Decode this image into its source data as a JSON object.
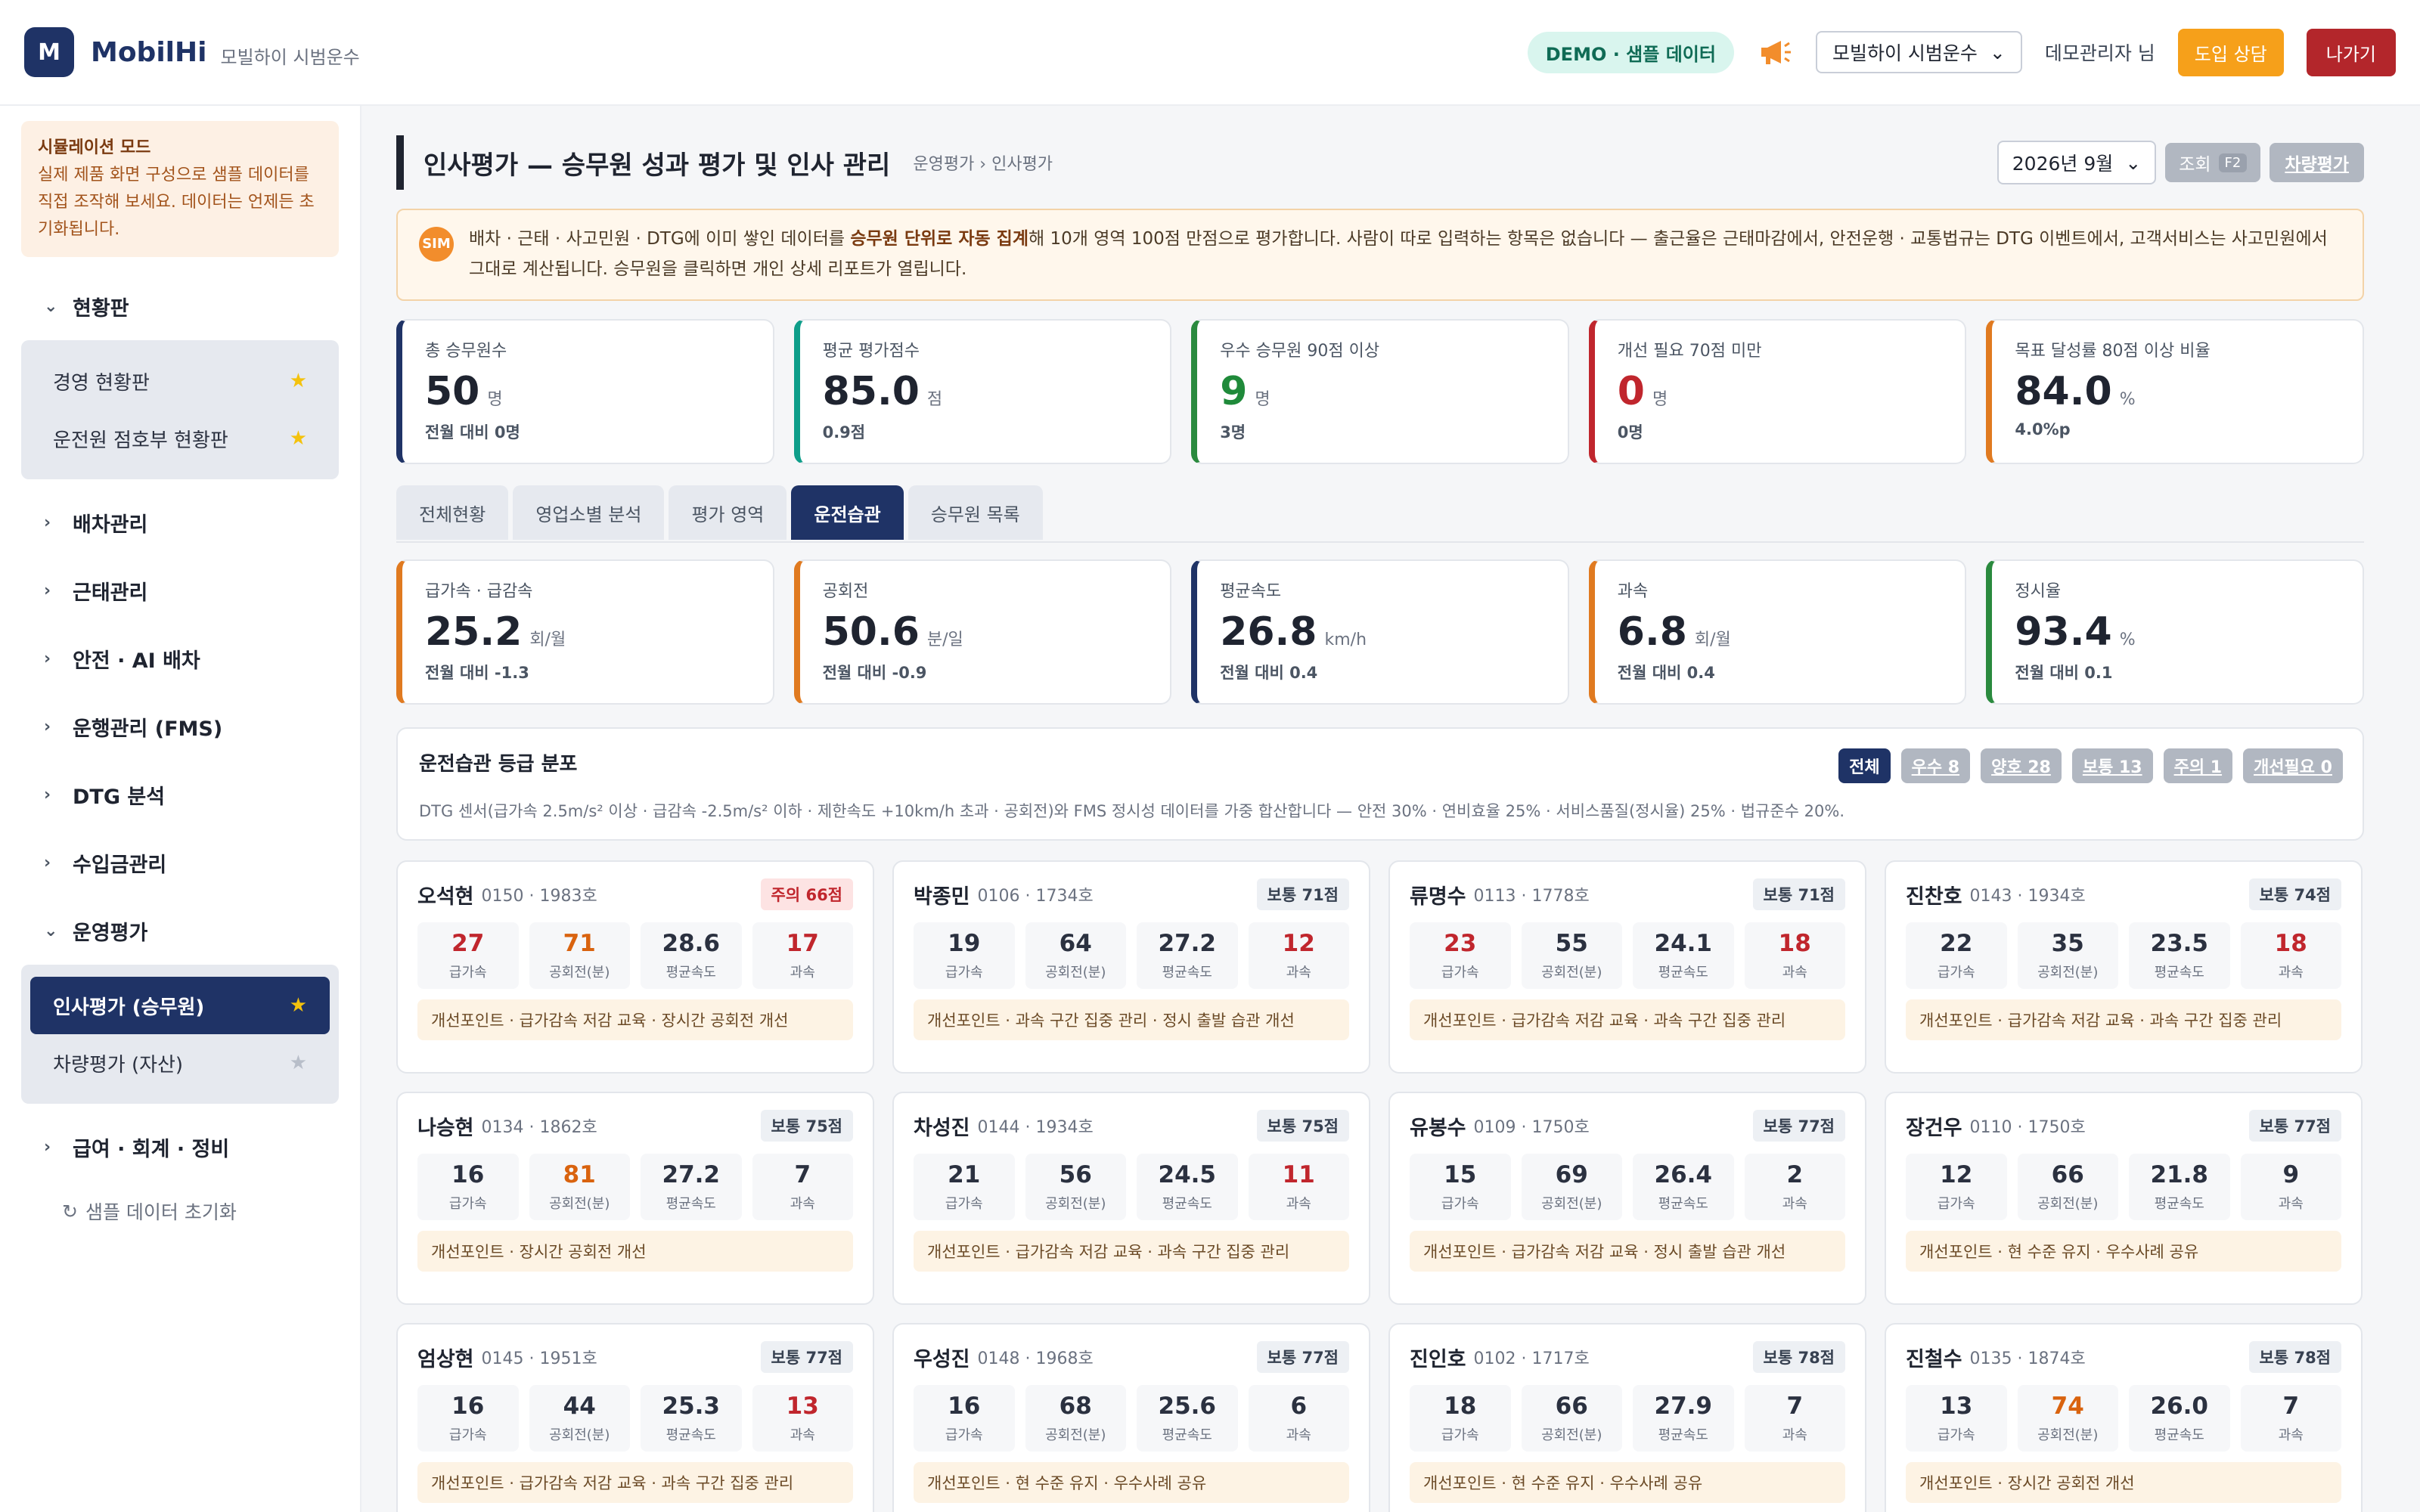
{
  "app": {
    "logo_letter": "M",
    "brand": "MobilHi",
    "brand_sub": "모빌하이 시범운수"
  },
  "header": {
    "demo_badge": "DEMO · 샘플 데이터",
    "company_select": "모빌하이 시범운수",
    "user": "데모관리자 님",
    "consult_button": "도입 상담",
    "exit_button": "나가기"
  },
  "sidebar": {
    "sim_title": "시뮬레이션 모드",
    "sim_text": "실제 제품 화면 구성으로 샘플 데이터를 직접 조작해 보세요. 데이터는 언제든 초기화됩니다.",
    "sections": [
      {
        "label": "현황판",
        "expanded": true
      },
      {
        "label": "배차관리"
      },
      {
        "label": "근태관리"
      },
      {
        "label": "안전 · AI 배차"
      },
      {
        "label": "운행관리 (FMS)"
      },
      {
        "label": "DTG 분석"
      },
      {
        "label": "수입금관리"
      },
      {
        "label": "운영평가",
        "expanded": true
      },
      {
        "label": "급여 · 회계 · 정비"
      }
    ],
    "dashboard_items": [
      "경영 현황판",
      "운전원 점호부 현황판"
    ],
    "eval_items": [
      "인사평가 (승무원)",
      "차량평가 (자산)"
    ],
    "reset": "샘플 데이터 초기화"
  },
  "page": {
    "title": "인사평가 — 승무원 성과 평가 및 인사 관리",
    "breadcrumb": "운영평가 › 인사평가",
    "month": "2026년 9월",
    "query_button": "조회",
    "query_key": "F2",
    "vehicle_button": "차량평가"
  },
  "info": {
    "icon": "SIM",
    "p1": "배차 · 근태 · 사고민원 · DTG에 이미 쌓인 데이터를 ",
    "bold": "승무원 단위로 자동 집계",
    "p2": "해 10개 영역 100점 만점으로 평가합니다. 사람이 따로 입력하는 항목은 없습니다 — 출근율은 근태마감에서, 안전운행 · 교통법규는 DTG 이벤트에서, 고객서비스는 사고민원에서 그대로 계산됩니다. 승무원을 클릭하면 개인 상세 리포트가 열립니다."
  },
  "kpis": [
    {
      "label": "총 승무원수",
      "value": "50",
      "unit": "명",
      "sub": "전월 대비 0명"
    },
    {
      "label": "평균 평가점수",
      "value": "85.0",
      "unit": "점",
      "sub": "0.9점"
    },
    {
      "label": "우수 승무원 90점 이상",
      "value": "9",
      "unit": "명",
      "sub": "3명"
    },
    {
      "label": "개선 필요 70점 미만",
      "value": "0",
      "unit": "명",
      "sub": "0명"
    },
    {
      "label": "목표 달성률 80점 이상 비율",
      "value": "84.0",
      "unit": "%",
      "sub": "4.0%p"
    }
  ],
  "tabs": [
    "전체현황",
    "영업소별 분석",
    "평가 영역",
    "운전습관",
    "승무원 목록"
  ],
  "habits": [
    {
      "label": "급가속 · 급감속",
      "value": "25.2",
      "unit": "회/월",
      "sub": "전월 대비 -1.3"
    },
    {
      "label": "공회전",
      "value": "50.6",
      "unit": "분/일",
      "sub": "전월 대비 -0.9"
    },
    {
      "label": "평균속도",
      "value": "26.8",
      "unit": "km/h",
      "sub": "전월 대비 0.4"
    },
    {
      "label": "과속",
      "value": "6.8",
      "unit": "회/월",
      "sub": "전월 대비 0.4"
    },
    {
      "label": "정시율",
      "value": "93.4",
      "unit": "%",
      "sub": "전월 대비 0.1"
    }
  ],
  "distribution": {
    "title": "운전습관 등급 분포",
    "desc": "DTG 센서(급가속 2.5m/s² 이상 · 급감속 -2.5m/s² 이하 · 제한속도 +10km/h 초과 · 공회전)와 FMS 정시성 데이터를 가중 합산합니다 — 안전 30% · 연비효율 25% · 서비스품질(정시율) 25% · 법규준수 20%.",
    "filters": [
      "전체",
      "우수 8",
      "양호 28",
      "보통 13",
      "주의 1",
      "개선필요 0"
    ]
  },
  "metric_labels": [
    "급가속",
    "공회전(분)",
    "평균속도",
    "과속"
  ],
  "drivers": [
    {
      "name": "오석현",
      "id": "0150 · 1983호",
      "grade": "주의 66점",
      "v": [
        "27",
        "71",
        "28.6",
        "17"
      ],
      "tip": "개선포인트 · 급가감속 저감 교육 · 장시간 공회전 개선"
    },
    {
      "name": "박종민",
      "id": "0106 · 1734호",
      "grade": "보통 71점",
      "v": [
        "19",
        "64",
        "27.2",
        "12"
      ],
      "tip": "개선포인트 · 과속 구간 집중 관리 · 정시 출발 습관 개선"
    },
    {
      "name": "류명수",
      "id": "0113 · 1778호",
      "grade": "보통 71점",
      "v": [
        "23",
        "55",
        "24.1",
        "18"
      ],
      "tip": "개선포인트 · 급가감속 저감 교육 · 과속 구간 집중 관리"
    },
    {
      "name": "진찬호",
      "id": "0143 · 1934호",
      "grade": "보통 74점",
      "v": [
        "22",
        "35",
        "23.5",
        "18"
      ],
      "tip": "개선포인트 · 급가감속 저감 교육 · 과속 구간 집중 관리"
    },
    {
      "name": "나승현",
      "id": "0134 · 1862호",
      "grade": "보통 75점",
      "v": [
        "16",
        "81",
        "27.2",
        "7"
      ],
      "tip": "개선포인트 · 장시간 공회전 개선"
    },
    {
      "name": "차성진",
      "id": "0144 · 1934호",
      "grade": "보통 75점",
      "v": [
        "21",
        "56",
        "24.5",
        "11"
      ],
      "tip": "개선포인트 · 급가감속 저감 교육 · 과속 구간 집중 관리"
    },
    {
      "name": "유봉수",
      "id": "0109 · 1750호",
      "grade": "보통 77점",
      "v": [
        "15",
        "69",
        "26.4",
        "2"
      ],
      "tip": "개선포인트 · 급가감속 저감 교육 · 정시 출발 습관 개선"
    },
    {
      "name": "장건우",
      "id": "0110 · 1750호",
      "grade": "보통 77점",
      "v": [
        "12",
        "66",
        "21.8",
        "9"
      ],
      "tip": "개선포인트 · 현 수준 유지 · 우수사례 공유"
    },
    {
      "name": "엄상현",
      "id": "0145 · 1951호",
      "grade": "보통 77점",
      "v": [
        "16",
        "44",
        "25.3",
        "13"
      ],
      "tip": "개선포인트 · 급가감속 저감 교육 · 과속 구간 집중 관리"
    },
    {
      "name": "우성진",
      "id": "0148 · 1968호",
      "grade": "보통 77점",
      "v": [
        "16",
        "68",
        "25.6",
        "6"
      ],
      "tip": "개선포인트 · 현 수준 유지 · 우수사례 공유"
    },
    {
      "name": "진인호",
      "id": "0102 · 1717호",
      "grade": "보통 78점",
      "v": [
        "18",
        "66",
        "27.9",
        "7"
      ],
      "tip": "개선포인트 · 현 수준 유지 · 우수사례 공유"
    },
    {
      "name": "진철수",
      "id": "0135 · 1874호",
      "grade": "보통 78점",
      "v": [
        "13",
        "74",
        "26.0",
        "7"
      ],
      "tip": "개선포인트 · 장시간 공회전 개선"
    }
  ]
}
